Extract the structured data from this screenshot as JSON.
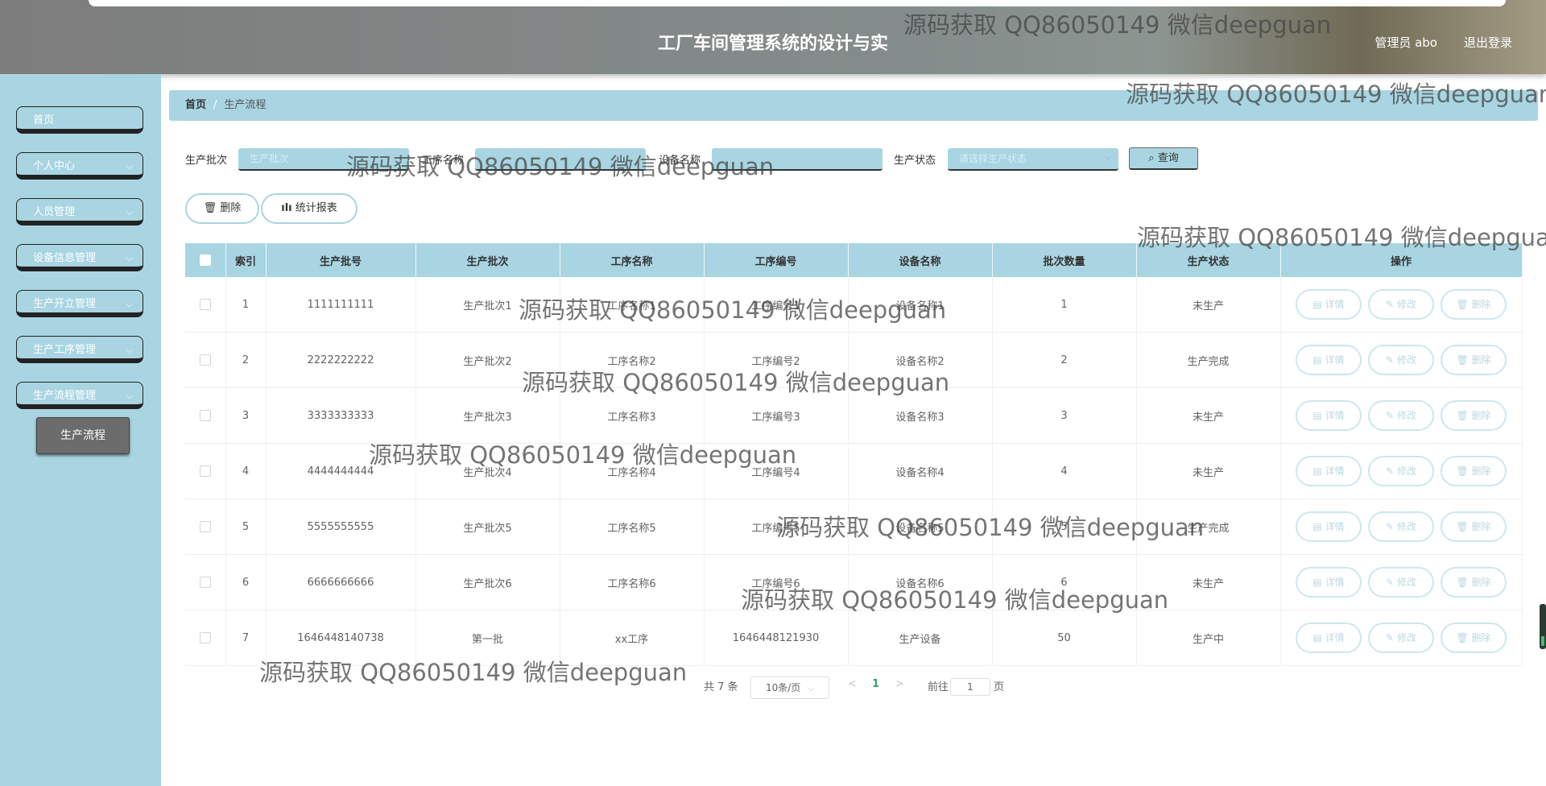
{
  "header": {
    "title": "工厂车间管理系统的设计与实",
    "user": "管理员 abo",
    "logout": "退出登录"
  },
  "sidebar": {
    "items": [
      {
        "label": "首页",
        "has_children": false
      },
      {
        "label": "个人中心",
        "has_children": true
      },
      {
        "label": "人员管理",
        "has_children": true
      },
      {
        "label": "设备信息管理",
        "has_children": true
      },
      {
        "label": "生产开立管理",
        "has_children": true
      },
      {
        "label": "生产工序管理",
        "has_children": true
      },
      {
        "label": "生产流程管理",
        "has_children": true
      }
    ],
    "active_sub": "生产流程"
  },
  "breadcrumb": {
    "home": "首页",
    "separator": "/",
    "current": "生产流程"
  },
  "search": {
    "batch_label": "生产批次",
    "batch_placeholder": "生产批次",
    "process_label": "工序名称",
    "process_placeholder": "",
    "device_label": "设备名称",
    "device_placeholder": "",
    "status_label": "生产状态",
    "status_placeholder": "请选择生产状态",
    "query_button": "查询"
  },
  "actions": {
    "delete": "删除",
    "stats": "统计报表"
  },
  "table": {
    "headers": [
      "索引",
      "生产批号",
      "生产批次",
      "工序名称",
      "工序编号",
      "设备名称",
      "批次数量",
      "生产状态",
      "操作"
    ],
    "row_buttons": {
      "detail": "详情",
      "edit": "修改",
      "delete": "删除"
    },
    "rows": [
      {
        "index": "1",
        "batch_no": "1111111111",
        "batch": "生产批次1",
        "process": "工序名称1",
        "process_no": "工序编号1",
        "device": "设备名称1",
        "qty": "1",
        "status": "未生产"
      },
      {
        "index": "2",
        "batch_no": "2222222222",
        "batch": "生产批次2",
        "process": "工序名称2",
        "process_no": "工序编号2",
        "device": "设备名称2",
        "qty": "2",
        "status": "生产完成"
      },
      {
        "index": "3",
        "batch_no": "3333333333",
        "batch": "生产批次3",
        "process": "工序名称3",
        "process_no": "工序编号3",
        "device": "设备名称3",
        "qty": "3",
        "status": "未生产"
      },
      {
        "index": "4",
        "batch_no": "4444444444",
        "batch": "生产批次4",
        "process": "工序名称4",
        "process_no": "工序编号4",
        "device": "设备名称4",
        "qty": "4",
        "status": "未生产"
      },
      {
        "index": "5",
        "batch_no": "5555555555",
        "batch": "生产批次5",
        "process": "工序名称5",
        "process_no": "工序编号5",
        "device": "设备名称5",
        "qty": "5",
        "status": "生产完成"
      },
      {
        "index": "6",
        "batch_no": "6666666666",
        "batch": "生产批次6",
        "process": "工序名称6",
        "process_no": "工序编号6",
        "device": "设备名称6",
        "qty": "6",
        "status": "未生产"
      },
      {
        "index": "7",
        "batch_no": "1646448140738",
        "batch": "第一批",
        "process": "xx工序",
        "process_no": "1646448121930",
        "device": "生产设备",
        "qty": "50",
        "status": "生产中"
      }
    ]
  },
  "pagination": {
    "total": "共 7 条",
    "page_size": "10条/页",
    "current_page": "1",
    "prev": "<",
    "next": ">",
    "goto_label": "前往",
    "goto_value": "1",
    "goto_suffix": "页"
  },
  "watermark": "源码获取 QQ86050149 微信deepguan"
}
